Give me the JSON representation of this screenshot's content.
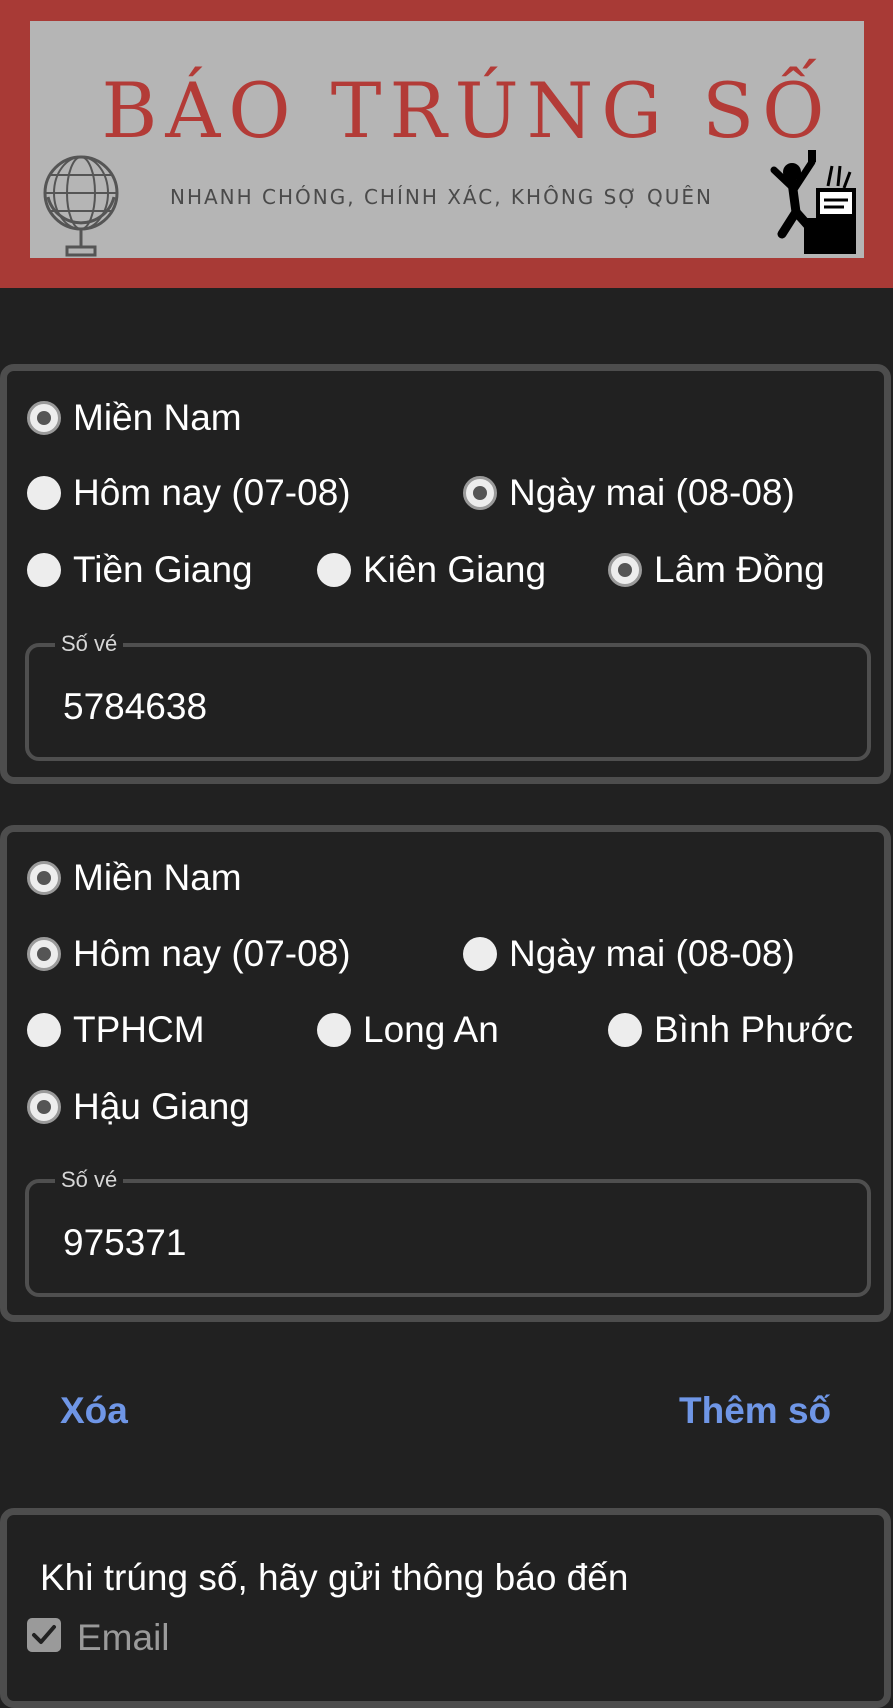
{
  "header": {
    "title": "BÁO TRÚNG SỐ",
    "subtitle": "NHANH CHÓNG, CHÍNH XÁC, KHÔNG SỢ QUÊN"
  },
  "colors": {
    "header_bg": "#a83a36",
    "banner_bg": "#b5b5b5",
    "title_color": "#b33b37",
    "page_bg": "#212121",
    "accent": "#6f96e6"
  },
  "tickets": [
    {
      "region": {
        "label": "Miền Nam",
        "selected": true
      },
      "days": [
        {
          "label": "Hôm nay (07-08)",
          "selected": false
        },
        {
          "label": "Ngày mai (08-08)",
          "selected": true
        }
      ],
      "provinces": [
        {
          "label": "Tiền Giang",
          "selected": false
        },
        {
          "label": "Kiên Giang",
          "selected": false
        },
        {
          "label": "Lâm Đồng",
          "selected": true
        }
      ],
      "field_label": "Số vé",
      "number": "5784638"
    },
    {
      "region": {
        "label": "Miền Nam",
        "selected": true
      },
      "days": [
        {
          "label": "Hôm nay (07-08)",
          "selected": true
        },
        {
          "label": "Ngày mai (08-08)",
          "selected": false
        }
      ],
      "provinces": [
        {
          "label": "TPHCM",
          "selected": false
        },
        {
          "label": "Long An",
          "selected": false
        },
        {
          "label": "Bình Phước",
          "selected": false
        },
        {
          "label": "Hậu Giang",
          "selected": true
        }
      ],
      "field_label": "Số vé",
      "number": "975371"
    }
  ],
  "actions": {
    "delete_label": "Xóa",
    "add_label": "Thêm số"
  },
  "notify": {
    "title": "Khi trúng số, hãy gửi thông báo đến",
    "email_label": "Email",
    "email_checked": true
  }
}
